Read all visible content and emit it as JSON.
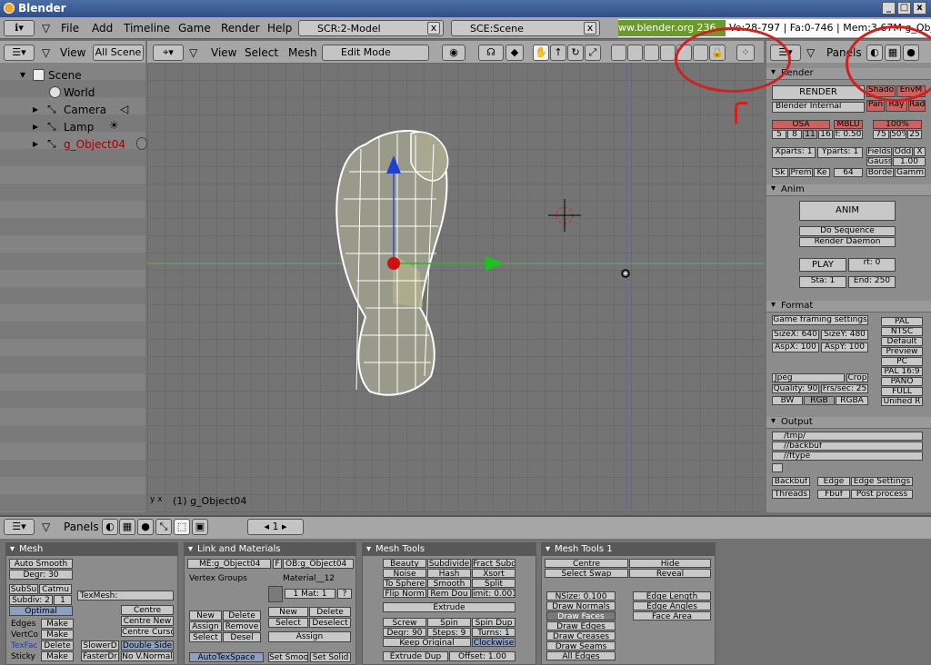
{
  "window": {
    "title": "Blender",
    "btn_min": "_",
    "btn_max": "□",
    "btn_close": "x"
  },
  "menubar": {
    "items": [
      "File",
      "Add",
      "Timeline",
      "Game",
      "Render",
      "Help"
    ],
    "screen": "SCR:2-Model",
    "scene": "SCE:Scene",
    "url": "www.blender.org 236",
    "stats": "Ve:28-797 | Fa:0-746 | Mem:3.67M g_Obje"
  },
  "outliner_header": {
    "view": "View",
    "scope": "All Scene"
  },
  "outliner": {
    "items": [
      "Scene",
      "World",
      "Camera",
      "Lamp",
      "g_Object04"
    ]
  },
  "view_header": {
    "view": "View",
    "select": "Select",
    "mesh": "Mesh",
    "mode": "Edit Mode"
  },
  "view3d": {
    "status": "(1) g_Object04",
    "axis_x": "x",
    "axis_y": "y"
  },
  "buttons_header": {
    "label": "Panels"
  },
  "render": {
    "title": "Render",
    "render_btn": "RENDER",
    "shadow": "Shado",
    "envmap": "EnvM",
    "engine": "Blender Internal",
    "pano": "Pan",
    "ray": "Ray",
    "radio": "Radi",
    "osa": "OSA",
    "mblur": "MBLU",
    "percent": "100%",
    "osa_vals": [
      "5",
      "8",
      "11",
      "16"
    ],
    "filter": "f: 0.50",
    "size_vals": [
      "75",
      "50%",
      "25"
    ],
    "xparts": "Xparts: 1",
    "yparts": "Yparts: 1",
    "fields": "Fields",
    "odd": "Odd",
    "x": "X",
    "gauss": "Gauss",
    "gauss_val": "1.00",
    "sky": "Sk",
    "premul": "Prem",
    "key": "Ke",
    "bits": "64",
    "border": "Borde",
    "gamma": "Gamm"
  },
  "anim": {
    "title": "Anim",
    "anim_btn": "ANIM",
    "do_sequence": "Do Sequence",
    "render_daemon": "Render Daemon",
    "play": "PLAY",
    "rt": "rt: 0",
    "sta": "Sta: 1",
    "end": "End: 250"
  },
  "format": {
    "title": "Format",
    "game_framing": "Game framing settings",
    "sizex": "SizeX: 640",
    "sizey": "SizeY: 480",
    "aspx": "AspX: 100",
    "aspy": "AspY: 100",
    "presets": [
      "PAL",
      "NTSC",
      "Default",
      "Preview",
      "PC",
      "PAL 16:9",
      "PANO",
      "FULL",
      "Unified R"
    ],
    "filetype": "Jpeg",
    "crop": "Crop",
    "quality": "Quality: 90",
    "fps": "Frs/sec: 25",
    "bw": "BW",
    "rgb": "RGB",
    "rgba": "RGBA"
  },
  "output": {
    "title": "Output",
    "paths": [
      "/tmp/",
      "//backbuf",
      "//ftype"
    ],
    "backbuf": "Backbuf",
    "edge": "Edge",
    "edge_settings": "Edge Settings",
    "threads": "Threads",
    "fbuf": "Fbuf",
    "post_process": "Post process"
  },
  "bottom_header": {
    "label": "Panels",
    "frame": "1"
  },
  "mesh_panel": {
    "title": "Mesh",
    "auto_smooth": "Auto Smooth",
    "degr": "Degr: 30",
    "subsurf": "SubSu",
    "catmull": "Catmu",
    "subdiv": "Subdiv: 2",
    "subdiv2": "1",
    "optimal": "Optimal",
    "texmesh": "TexMesh:",
    "edges": "Edges",
    "vertcol": "VertCo",
    "texface": "TexFac",
    "sticky": "Sticky",
    "make": "Make",
    "delete": "Delete",
    "centre": "Centre",
    "centre_new": "Centre New",
    "centre_cursor": "Centre Curso",
    "slower_draw": "SlowerD",
    "faster_draw": "FasterDr",
    "double_sided": "Double Side",
    "no_vnormal": "No V.Normal"
  },
  "link_panel": {
    "title": "Link and Materials",
    "me": "ME:g_Object04",
    "f": "F",
    "ob": "OB:g_Object04",
    "vertex_groups": "Vertex Groups",
    "material": "Material__12",
    "mat": "1 Mat: 1",
    "q": "?",
    "new": "New",
    "delete": "Delete",
    "assign": "Assign",
    "remove": "Remove",
    "select": "Select",
    "deselect": "Desel",
    "deselect2": "Deselect",
    "autotex": "AutoTexSpace",
    "set_smooth": "Set Smoot",
    "set_solid": "Set Solid"
  },
  "mesh_tools": {
    "title": "Mesh Tools",
    "beauty": "Beauty",
    "subdivide": "Subdivide",
    "fract": "Fract Subd",
    "noise": "Noise",
    "hash": "Hash",
    "xsort": "Xsort",
    "to_sphere": "To Sphere",
    "smooth": "Smooth",
    "split": "Split",
    "flip_normals": "Flip Norm",
    "rem_doubles": "Rem Dou",
    "limit": "imit: 0.001",
    "extrude": "Extrude",
    "screw": "Screw",
    "spin": "Spin",
    "spin_dup": "Spin Dup",
    "degr": "Degr: 90",
    "steps": "Steps: 9",
    "turns": "Turns: 1",
    "keep_original": "Keep Original",
    "clockwise": "Clockwise",
    "extrude_dup": "Extrude Dup",
    "offset": "Offset: 1.00"
  },
  "mesh_tools1": {
    "title": "Mesh Tools 1",
    "centre": "Centre",
    "hide": "Hide",
    "select_swap": "Select Swap",
    "reveal": "Reveal",
    "nsize": "NSize: 0.100",
    "draw_normals": "Draw Normals",
    "draw_faces": "Draw Faces",
    "draw_edges": "Draw Edges",
    "draw_creases": "Draw Creases",
    "draw_seams": "Draw Seams",
    "all_edges": "All Edges",
    "edge_length": "Edge Length",
    "edge_angles": "Edge Angles",
    "face_area": "Face Area"
  }
}
